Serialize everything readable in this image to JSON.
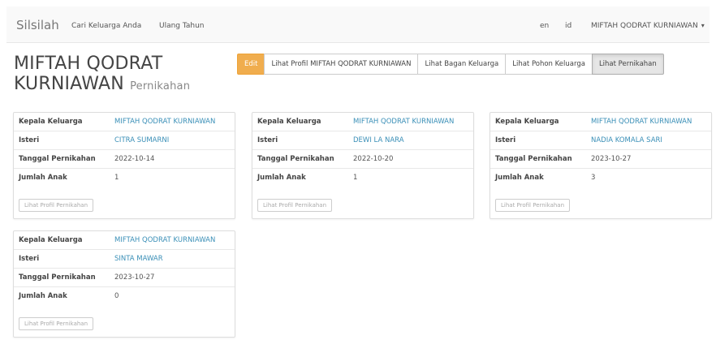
{
  "navbar": {
    "brand": "Silsilah",
    "links": [
      "Cari Keluarga Anda",
      "Ulang Tahun"
    ],
    "lang_en": "en",
    "lang_id": "id",
    "user": "MIFTAH QODRAT KURNIAWAN"
  },
  "page": {
    "title": "MIFTAH QODRAT KURNIAWAN",
    "subtitle": "Pernikahan"
  },
  "actions": {
    "edit": "Edit",
    "profile": "Lihat Profil MIFTAH QODRAT KURNIAWAN",
    "family_chart": "Lihat Bagan Keluarga",
    "family_tree": "Lihat Pohon Keluarga",
    "marriages": "Lihat Pernikahan"
  },
  "labels": {
    "head": "Kepala Keluarga",
    "wife": "Isteri",
    "date": "Tanggal Pernikahan",
    "children": "Jumlah Anak",
    "view_button": "Lihat Profil Pernikahan"
  },
  "marriages": [
    {
      "head": "MIFTAH QODRAT KURNIAWAN",
      "wife": "CITRA SUMARNI",
      "date": "2022-10-14",
      "children": "1"
    },
    {
      "head": "MIFTAH QODRAT KURNIAWAN",
      "wife": "DEWI LA NARA",
      "date": "2022-10-20",
      "children": "1"
    },
    {
      "head": "MIFTAH QODRAT KURNIAWAN",
      "wife": "NADIA KOMALA SARI",
      "date": "2023-10-27",
      "children": "3"
    },
    {
      "head": "MIFTAH QODRAT KURNIAWAN",
      "wife": "SINTA MAWAR",
      "date": "2023-10-27",
      "children": "0"
    }
  ]
}
